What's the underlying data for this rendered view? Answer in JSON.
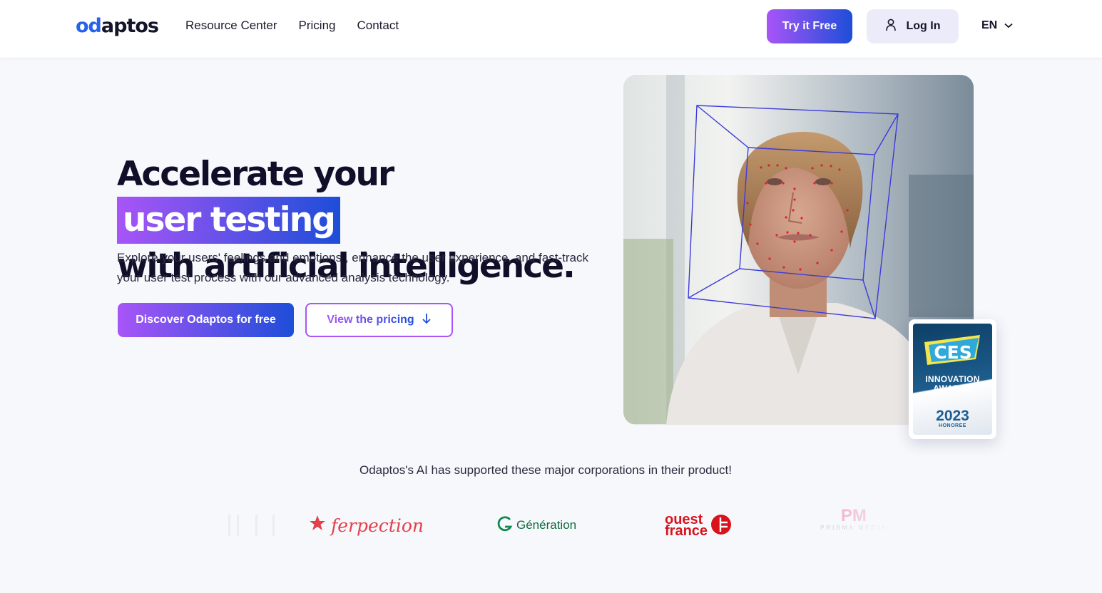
{
  "header": {
    "logo_text_a": "od",
    "logo_text_b": "aptos",
    "nav": [
      "Resource Center",
      "Pricing",
      "Contact"
    ],
    "try_label": "Try it Free",
    "login_label": "Log In",
    "lang_label": "EN"
  },
  "hero": {
    "headline_a": "Accelerate your",
    "headline_highlight": "user testing",
    "headline_b": "with artificial intelligence.",
    "subtitle": "Explore your users' feelings and emotions , enhance the user experience, and fast-track your user test process with our advanced analysis technology.",
    "discover_label": "Discover Odaptos for free",
    "pricing_label": "View the pricing"
  },
  "badge": {
    "ces": "CES",
    "innovation": "INNOVATION",
    "awards": "AWARDS",
    "year": "2023",
    "honoree": "HONOREE"
  },
  "clients": {
    "title": "Odaptos's AI has supported these major corporations in their product!",
    "ferpection": "ferpection",
    "generation": "Génération",
    "ouest_a": "ouest",
    "ouest_b": "france",
    "prisma": "PM",
    "prisma_sub": "PRISMA MEDIA"
  },
  "colors": {
    "gradient_start": "#a855f7",
    "gradient_end": "#1d4ed8",
    "login_bg": "#ecebf9",
    "page_bg": "#f7f8fc"
  }
}
